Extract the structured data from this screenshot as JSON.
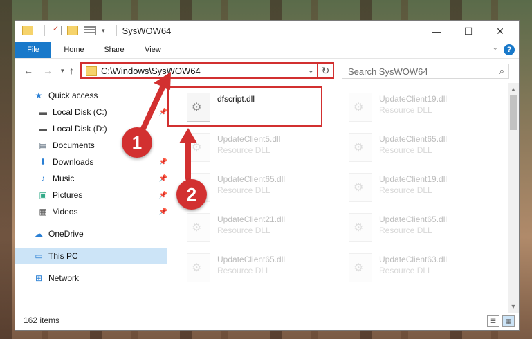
{
  "window": {
    "title": "SysWOW64"
  },
  "ribbon": {
    "tabs": [
      "File",
      "Home",
      "Share",
      "View"
    ]
  },
  "address": {
    "path": "C:\\Windows\\SysWOW64"
  },
  "search": {
    "placeholder": "Search SysWOW64"
  },
  "sidebar": {
    "items": [
      {
        "label": "Quick access",
        "icon": "star-icon"
      },
      {
        "label": "Local Disk (C:)",
        "icon": "drive-icon"
      },
      {
        "label": "Local Disk (D:)",
        "icon": "drive-icon"
      },
      {
        "label": "Documents",
        "icon": "documents-icon"
      },
      {
        "label": "Downloads",
        "icon": "download-icon"
      },
      {
        "label": "Music",
        "icon": "music-icon"
      },
      {
        "label": "Pictures",
        "icon": "pictures-icon"
      },
      {
        "label": "Videos",
        "icon": "videos-icon"
      },
      {
        "label": "OneDrive",
        "icon": "cloud-icon"
      },
      {
        "label": "This PC",
        "icon": "computer-icon"
      },
      {
        "label": "Network",
        "icon": "network-icon"
      }
    ]
  },
  "files": [
    {
      "name": "dfscript.dll",
      "type": ""
    },
    {
      "name": "UpdateClient19.dll",
      "type": "Resource DLL"
    },
    {
      "name": "UpdateClient5.dll",
      "type": "Resource DLL"
    },
    {
      "name": "UpdateClient65.dll",
      "type": "Resource DLL"
    },
    {
      "name": "UpdateClient65.dll",
      "type": "Resource DLL"
    },
    {
      "name": "UpdateClient19.dll",
      "type": "Resource DLL"
    },
    {
      "name": "UpdateClient21.dll",
      "type": "Resource DLL"
    },
    {
      "name": "UpdateClient65.dll",
      "type": "Resource DLL"
    },
    {
      "name": "UpdateClient65.dll",
      "type": "Resource DLL"
    },
    {
      "name": "UpdateClient63.dll",
      "type": "Resource DLL"
    }
  ],
  "status": {
    "count": "162 items"
  },
  "callouts": [
    "1",
    "2"
  ],
  "colors": {
    "accent": "#1979ca",
    "highlight": "#d23030",
    "selection": "#cce4f7"
  }
}
